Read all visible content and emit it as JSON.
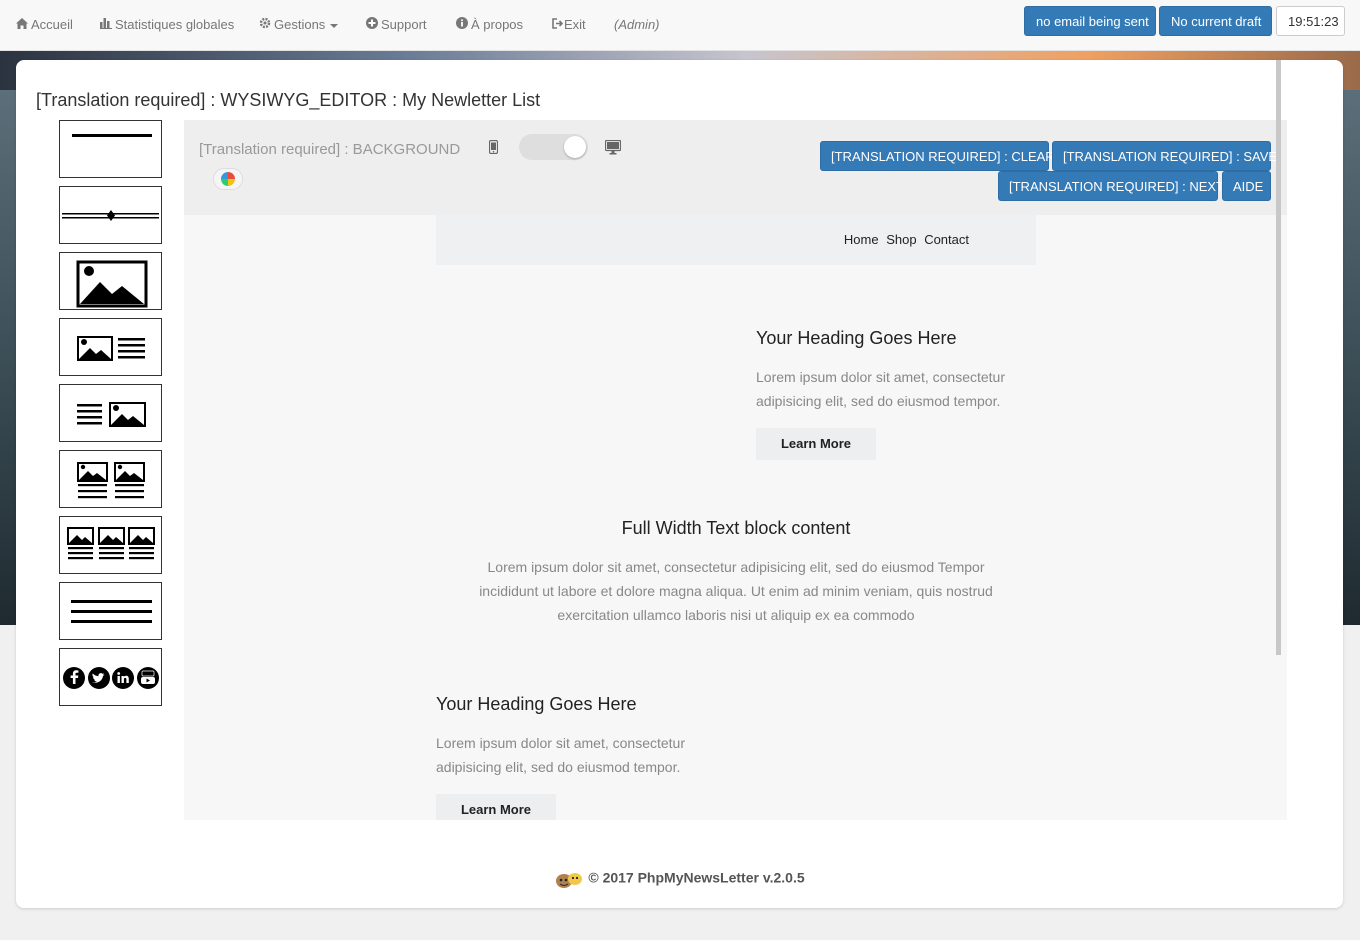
{
  "navbar": {
    "items": [
      {
        "label": "Accueil",
        "icon": "home-icon"
      },
      {
        "label": "Statistiques globales",
        "icon": "bar-chart-icon"
      },
      {
        "label": "Gestions",
        "icon": "gear-icon"
      },
      {
        "label": "Support",
        "icon": "plus-circle-icon"
      },
      {
        "label": "À propos",
        "icon": "info-circle-icon"
      },
      {
        "label": "Exit",
        "icon": "sign-out-icon"
      }
    ],
    "admin": "(Admin)",
    "email_status": "no email being sent",
    "draft_status": "No current draft",
    "clock": "19:51:23"
  },
  "page": {
    "title": "[Translation required] : WYSIWYG_EDITOR : My Newletter List"
  },
  "palette": {
    "blocks": [
      {
        "name": "palette-divider-line"
      },
      {
        "name": "palette-divider-diamond"
      },
      {
        "name": "palette-image-full"
      },
      {
        "name": "palette-image-left-text"
      },
      {
        "name": "palette-text-image-right"
      },
      {
        "name": "palette-two-columns"
      },
      {
        "name": "palette-three-columns"
      },
      {
        "name": "palette-text-block"
      },
      {
        "name": "palette-social-icons"
      }
    ],
    "social_icons": [
      "facebook-icon",
      "twitter-icon",
      "linkedin-icon",
      "youtube-icon"
    ]
  },
  "editor": {
    "background_label": "[Translation required] : BACKGROUND",
    "buttons": {
      "clear": "[TRANSLATION REQUIRED] : CLEAR",
      "save": "[TRANSLATION REQUIRED] : SAVE",
      "next": "[TRANSLATION REQUIRED] : NEXT",
      "help": "AIDE"
    },
    "mode_icons": {
      "mobile": "mobile-icon",
      "desktop": "desktop-icon"
    }
  },
  "email": {
    "nav_links": [
      "Home",
      "Shop",
      "Contact"
    ],
    "block1": {
      "heading": "Your Heading Goes Here",
      "text": "Lorem ipsum dolor sit amet, consectetur adipisicing elit, sed do eiusmod tempor.",
      "button": "Learn More"
    },
    "block2": {
      "heading": "Full Width Text block content",
      "text": "Lorem ipsum dolor sit amet, consectetur adipisicing elit, sed do eiusmod Tempor incididunt ut labore et dolore magna aliqua. Ut enim ad minim veniam, quis nostrud exercitation ullamco laboris nisi ut aliquip ex ea commodo"
    },
    "block3": {
      "heading": "Your Heading Goes Here",
      "text": "Lorem ipsum dolor sit amet, consectetur adipisicing elit, sed do eiusmod tempor.",
      "button": "Learn More"
    }
  },
  "footer": {
    "text": "© 2017 PhpMyNewsLetter v.2.0.5"
  },
  "colors": {
    "primary": "#337ab7",
    "navbar_bg": "#f8f8f8",
    "editor_bar": "#eeeeee"
  }
}
